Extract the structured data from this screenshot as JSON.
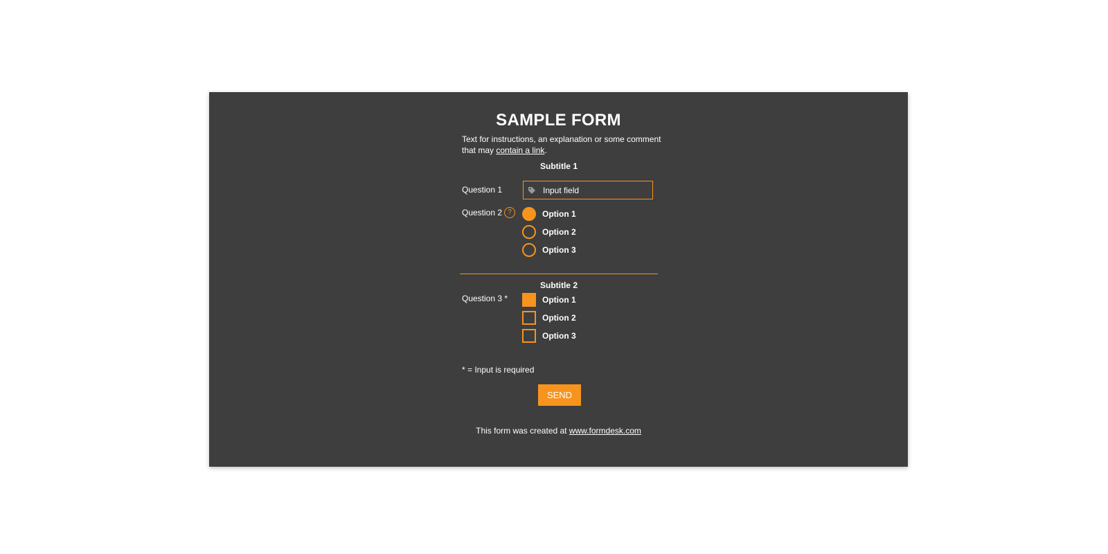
{
  "form": {
    "title": "SAMPLE FORM",
    "intro_text": "Text for instructions, an explanation or some comment that may ",
    "intro_link": "contain a link",
    "intro_end": ".",
    "subtitle_1": "Subtitle 1",
    "subtitle_2": "Subtitle 2",
    "question_1": {
      "label": "Question 1",
      "input_value": "Input field",
      "icon": "tag-icon"
    },
    "question_2": {
      "label": "Question 2",
      "help_icon": "?",
      "options": [
        "Option 1",
        "Option 2",
        "Option 3"
      ],
      "selected_index": 0
    },
    "question_3": {
      "label": "Question 3 *",
      "options": [
        "Option 1",
        "Option 2",
        "Option 3"
      ],
      "checked": [
        true,
        false,
        false
      ]
    },
    "required_note": "* = Input is required",
    "send_label": "SEND",
    "footer_text": "This form was created at ",
    "footer_link": "www.formdesk.com"
  },
  "colors": {
    "background": "#ffffff",
    "card": "#3e3e3e",
    "accent": "#f7941d",
    "text": "#ffffff"
  }
}
